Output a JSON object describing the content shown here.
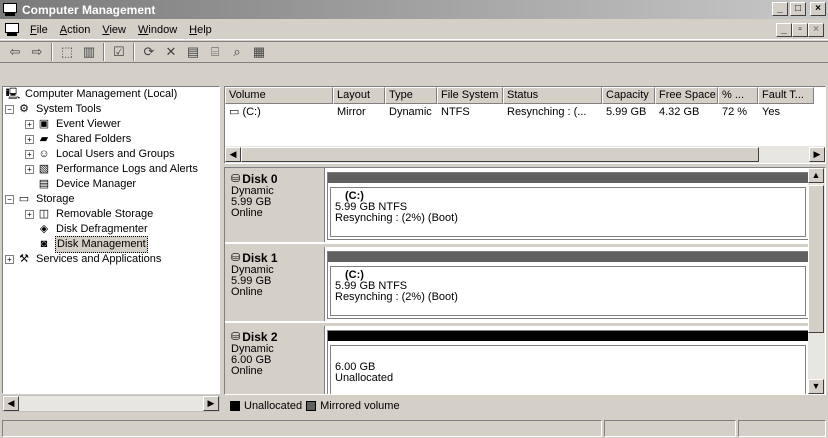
{
  "window": {
    "title": "Computer Management",
    "controls": [
      "_",
      "□",
      "×"
    ],
    "doc_controls": [
      "_",
      "▫",
      "×"
    ]
  },
  "menu": [
    {
      "label": "File",
      "accel": "F"
    },
    {
      "label": "Action",
      "accel": "A"
    },
    {
      "label": "View",
      "accel": "V"
    },
    {
      "label": "Window",
      "accel": "W"
    },
    {
      "label": "Help",
      "accel": "H"
    }
  ],
  "toolbar": {
    "buttons": [
      {
        "icon": "back-arrow-icon",
        "glyph": "⇦",
        "enabled": true
      },
      {
        "icon": "forward-arrow-icon",
        "glyph": "⇨",
        "enabled": true
      },
      {
        "icon": "up-level-icon",
        "glyph": "⬚",
        "enabled": true
      },
      {
        "icon": "show-hide-tree-icon",
        "glyph": "▥",
        "enabled": true
      },
      {
        "icon": "properties-icon",
        "glyph": "☑",
        "enabled": true
      },
      {
        "icon": "refresh-icon",
        "glyph": "⟳",
        "enabled": true
      },
      {
        "icon": "delete-icon",
        "glyph": "✕",
        "enabled": true
      },
      {
        "icon": "properties-sheet-icon",
        "glyph": "▤",
        "enabled": true
      },
      {
        "icon": "open-icon",
        "glyph": "⌸",
        "enabled": true
      },
      {
        "icon": "search-icon",
        "glyph": "⌕",
        "enabled": true
      },
      {
        "icon": "settings-icon",
        "glyph": "▦",
        "enabled": true
      }
    ]
  },
  "tree": {
    "nodes": [
      {
        "label": "Computer Management (Local)",
        "level": 0,
        "expander": "",
        "icon": "computer-icon",
        "glyph": "🖳"
      },
      {
        "label": "System Tools",
        "level": 0,
        "expander": "−",
        "icon": "tools-icon",
        "glyph": "⚙"
      },
      {
        "label": "Event Viewer",
        "level": 1,
        "expander": "+",
        "icon": "event-viewer-icon",
        "glyph": "▣"
      },
      {
        "label": "Shared Folders",
        "level": 1,
        "expander": "+",
        "icon": "shared-folder-icon",
        "glyph": "▰"
      },
      {
        "label": "Local Users and Groups",
        "level": 1,
        "expander": "+",
        "icon": "users-icon",
        "glyph": "☺"
      },
      {
        "label": "Performance Logs and Alerts",
        "level": 1,
        "expander": "+",
        "icon": "performance-icon",
        "glyph": "▧"
      },
      {
        "label": "Device Manager",
        "level": 1,
        "expander": "",
        "icon": "device-manager-icon",
        "glyph": "▤"
      },
      {
        "label": "Storage",
        "level": 0,
        "expander": "−",
        "icon": "storage-icon",
        "glyph": "▭"
      },
      {
        "label": "Removable Storage",
        "level": 1,
        "expander": "+",
        "icon": "removable-storage-icon",
        "glyph": "◫"
      },
      {
        "label": "Disk Defragmenter",
        "level": 1,
        "expander": "",
        "icon": "defrag-icon",
        "glyph": "◈"
      },
      {
        "label": "Disk Management",
        "level": 1,
        "expander": "",
        "icon": "disk-management-icon",
        "glyph": "◙",
        "selected": true
      },
      {
        "label": "Services and Applications",
        "level": 0,
        "expander": "+",
        "icon": "services-icon",
        "glyph": "⚒"
      }
    ]
  },
  "volume_list": {
    "columns": [
      {
        "label": "Volume",
        "width": 108
      },
      {
        "label": "Layout",
        "width": 52
      },
      {
        "label": "Type",
        "width": 52
      },
      {
        "label": "File System",
        "width": 66
      },
      {
        "label": "Status",
        "width": 99
      },
      {
        "label": "Capacity",
        "width": 53
      },
      {
        "label": "Free Space",
        "width": 63
      },
      {
        "label": "% ...",
        "width": 40
      },
      {
        "label": "Fault T...",
        "width": 56
      }
    ],
    "rows": [
      {
        "cells": [
          "(C:)",
          "Mirror",
          "Dynamic",
          "NTFS",
          "Resynching : (...",
          "5.99 GB",
          "4.32 GB",
          "72 %",
          "Yes"
        ]
      }
    ]
  },
  "disks": [
    {
      "name": "Disk 0",
      "type": "Dynamic",
      "size": "5.99 GB",
      "state": "Online",
      "bar_color": "#606060",
      "partition": {
        "name": "(C:)",
        "line1": "5.99 GB NTFS",
        "line2": "Resynching : (2%) (Boot)"
      }
    },
    {
      "name": "Disk 1",
      "type": "Dynamic",
      "size": "5.99 GB",
      "state": "Online",
      "bar_color": "#606060",
      "partition": {
        "name": "(C:)",
        "line1": "5.99 GB NTFS",
        "line2": "Resynching : (2%) (Boot)"
      }
    },
    {
      "name": "Disk 2",
      "type": "Dynamic",
      "size": "6.00 GB",
      "state": "Online",
      "bar_color": "#000000",
      "partition": {
        "name": "",
        "line1": "6.00 GB",
        "line2": "Unallocated"
      }
    }
  ],
  "legend": [
    {
      "label": "Unallocated",
      "color": "#000000"
    },
    {
      "label": "Mirrored volume",
      "color": "#606060"
    }
  ]
}
